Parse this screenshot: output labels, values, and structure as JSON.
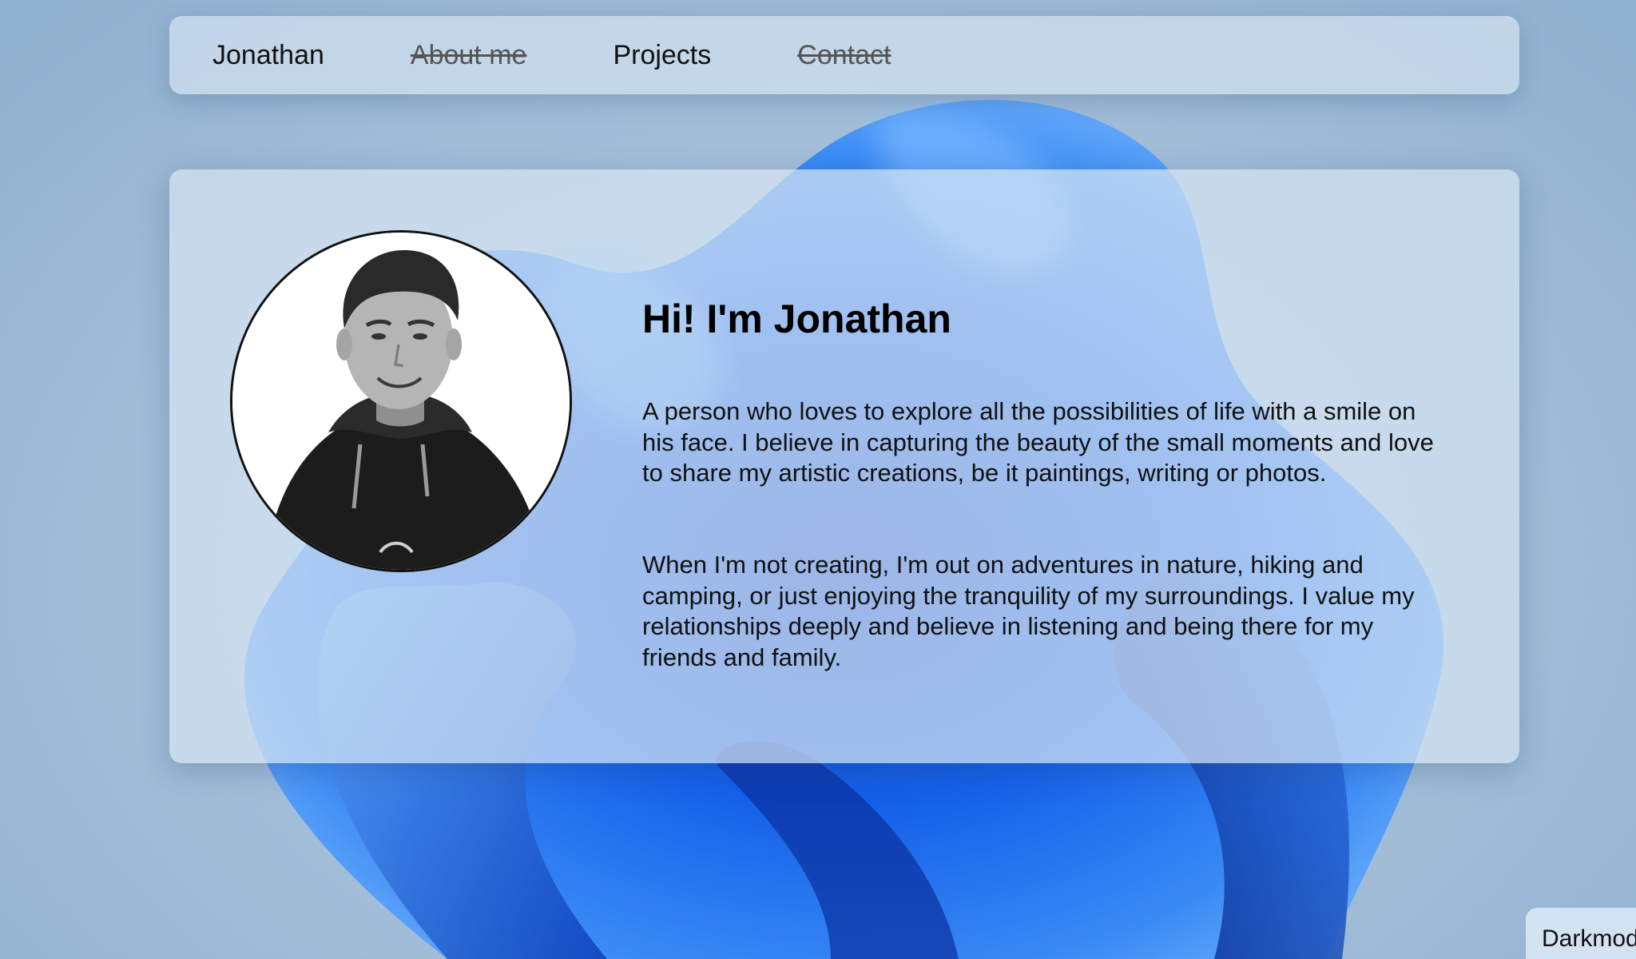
{
  "nav": {
    "items": [
      {
        "label": "Jonathan",
        "struck": false
      },
      {
        "label": "About me",
        "struck": true
      },
      {
        "label": "Projects",
        "struck": false
      },
      {
        "label": "Contact",
        "struck": true
      }
    ]
  },
  "hero": {
    "heading": "Hi! I'm Jonathan",
    "paragraph1": "A person who loves to explore all the possibilities of life with a smile on his face. I believe in capturing the beauty of the small moments and love to share my artistic creations, be it paintings, writing or photos.",
    "paragraph2": "When I'm not creating, I'm out on adventures in nature, hiking and camping, or just enjoying the tranquility of my surroundings. I value my relationships deeply and believe in listening and being there for my friends and family."
  },
  "darkmode": {
    "label": "Darkmode"
  },
  "colors": {
    "accent_blue": "#1a5fe0",
    "card_bg": "#d6e4f2",
    "text": "#111111"
  }
}
